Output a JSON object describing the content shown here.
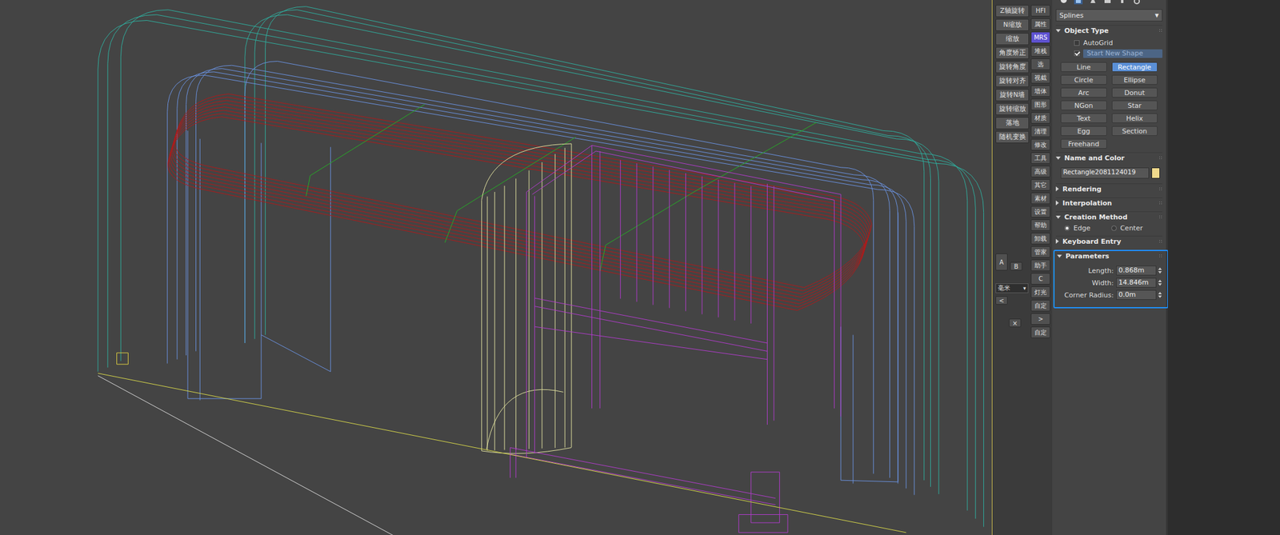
{
  "viewport": {
    "objects": [
      {
        "kind": "outer-arch",
        "color": "#2fae9e"
      },
      {
        "kind": "inner-arch",
        "color": "#6a92e0"
      },
      {
        "kind": "ceiling",
        "color": "#b01a1a"
      },
      {
        "kind": "guide",
        "color": "#25b025"
      },
      {
        "kind": "column",
        "color": "#e2e2a0"
      },
      {
        "kind": "door",
        "color": "#b13ccc"
      },
      {
        "kind": "ground-x",
        "color": "#d8d84a"
      },
      {
        "kind": "ground-y",
        "color": "#d9d9d9"
      },
      {
        "kind": "pivot",
        "color": "#e0d040"
      }
    ]
  },
  "toolbar": {
    "left_buttons": [
      "Z轴旋转",
      "N缩放",
      "缩放",
      "角度矫正",
      "旋转角度",
      "旋转对齐",
      "旋转N墙",
      "旋转缩放",
      "落地",
      "随机变换"
    ],
    "unit_controls": {
      "a": "A",
      "b": "B",
      "unit": "毫米",
      "unit_arrow": "▾",
      "prev": "<",
      "close": "×"
    },
    "right_buttons": [
      {
        "label": "HFI",
        "selected": false
      },
      {
        "label": "属性",
        "selected": false
      },
      {
        "label": "MRS",
        "selected": true
      },
      {
        "label": "堆栈",
        "selected": false
      },
      {
        "label": "选",
        "selected": false
      },
      {
        "label": "视截",
        "selected": false
      },
      {
        "label": "墙体",
        "selected": false
      },
      {
        "label": "图形",
        "selected": false
      },
      {
        "label": "材质",
        "selected": false
      },
      {
        "label": "清理",
        "selected": false
      },
      {
        "label": "修改",
        "selected": false
      },
      {
        "label": "工具",
        "selected": false
      },
      {
        "label": "高级",
        "selected": false
      },
      {
        "label": "其它",
        "selected": false
      },
      {
        "label": "素材",
        "selected": false
      },
      {
        "label": "设置",
        "selected": false
      },
      {
        "label": "帮助",
        "selected": false
      },
      {
        "label": "卸载",
        "selected": false
      },
      {
        "label": "管家",
        "selected": false
      },
      {
        "label": "助手",
        "selected": false
      },
      {
        "label": "C",
        "selected": false
      },
      {
        "label": "灯光",
        "selected": false
      },
      {
        "label": "自定",
        "selected": false
      },
      {
        "label": ">",
        "selected": false
      },
      {
        "label": "自定",
        "selected": false
      }
    ]
  },
  "command_panel": {
    "category": {
      "value": "Splines",
      "arrow": "▼"
    },
    "rollouts": [
      {
        "kind": "object-type",
        "title": "Object Type",
        "expanded": true,
        "autogrid": {
          "label": "AutoGrid",
          "checked": false
        },
        "start_new_shape": {
          "label": "Start New Shape",
          "checked": true
        },
        "buttons": [
          {
            "label": "Line",
            "selected": false
          },
          {
            "label": "Rectangle",
            "selected": true
          },
          {
            "label": "Circle",
            "selected": false
          },
          {
            "label": "Ellipse",
            "selected": false
          },
          {
            "label": "Arc",
            "selected": false
          },
          {
            "label": "Donut",
            "selected": false
          },
          {
            "label": "NGon",
            "selected": false
          },
          {
            "label": "Star",
            "selected": false
          },
          {
            "label": "Text",
            "selected": false
          },
          {
            "label": "Helix",
            "selected": false
          },
          {
            "label": "Egg",
            "selected": false
          },
          {
            "label": "Section",
            "selected": false
          },
          {
            "label": "Freehand",
            "selected": false
          }
        ]
      },
      {
        "kind": "name-color",
        "title": "Name and Color",
        "expanded": true,
        "name": "Rectangle2081124019",
        "color": "#f0d98c"
      },
      {
        "kind": "plain",
        "title": "Rendering",
        "expanded": false
      },
      {
        "kind": "plain",
        "title": "Interpolation",
        "expanded": false
      },
      {
        "kind": "radio",
        "title": "Creation Method",
        "expanded": true,
        "options": [
          {
            "label": "Edge",
            "selected": true
          },
          {
            "label": "Center",
            "selected": false
          }
        ]
      },
      {
        "kind": "plain",
        "title": "Keyboard Entry",
        "expanded": false
      },
      {
        "kind": "params",
        "title": "Parameters",
        "expanded": true,
        "highlighted": true,
        "fields": [
          {
            "label": "Length:",
            "value": "0.868m"
          },
          {
            "label": "Width:",
            "value": "14.846m"
          },
          {
            "label": "Corner Radius:",
            "value": "0.0m"
          }
        ]
      }
    ]
  }
}
